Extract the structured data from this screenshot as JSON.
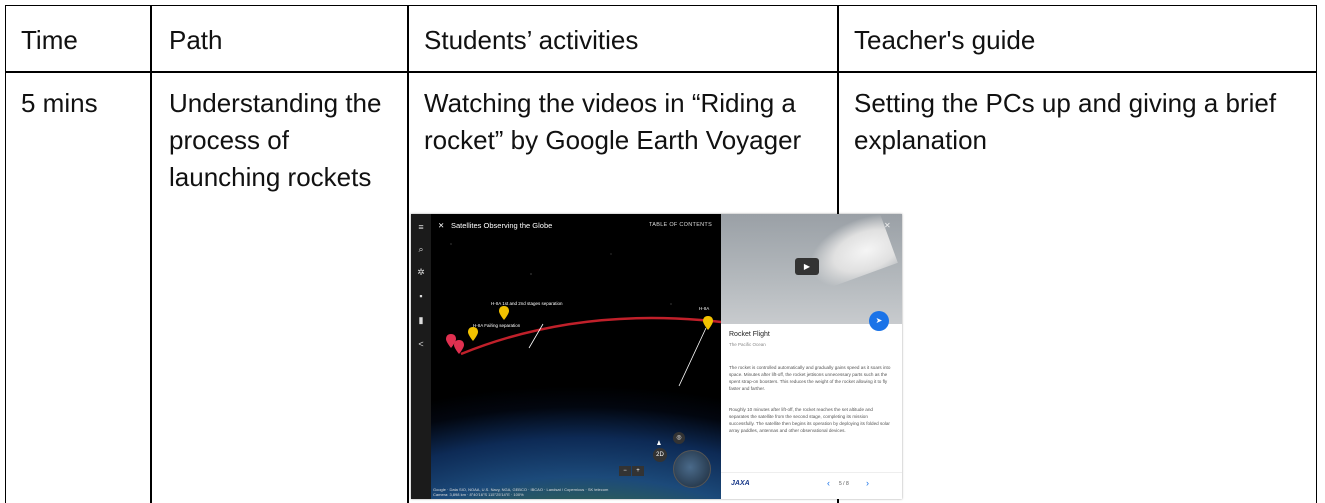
{
  "table": {
    "headers": [
      "Time",
      "Path",
      "Students’ activities",
      "Teacher's guide"
    ],
    "row": {
      "time": "5 mins",
      "path": "Understanding the process of launching rockets",
      "activity": "Watching the videos in “Riding a rocket” by Google Earth Voyager",
      "guide": "Setting the PCs up and giving a brief explanation"
    }
  },
  "screenshot": {
    "title": "Satellites Observing the Globe",
    "toc_label": "TABLE OF CONTENTS",
    "pins": [
      "H-IIA 1st and 2nd stages separation",
      "H-IIA Fairing separation",
      "H-IIA"
    ],
    "panel_title": "Rocket Flight",
    "panel_subtitle": "The Pacific Ocean",
    "paragraph1": "The rocket is controlled automatically and gradually gains speed as it soars into space. Minutes after lift-off, the rocket jettisons unnecessary parts such as the spent strap-on boosters. This reduces the weight of the rocket allowing it to fly faster and farther.",
    "paragraph2": "Roughly 10 minutes after lift-off, the rocket reaches the set altitude and separates the satellite from the second stage, completing its mission successfully. The satellite then begins its operation by deploying its folded solar array paddles, antennas and other observational devices.",
    "logo": "JAXA",
    "pager": "5 / 8",
    "credits": "Google · Data SIO, NOAA, U.S. Navy, NGA, GEBCO · IBCAO · Landsat / Copernicus · SK telecom",
    "camera": "Camera: 3,898 km · 8°40'16\"S 115°25'14\"E · 100%",
    "view_mode": "2D",
    "icons": [
      "menu-icon",
      "close-icon",
      "search-icon",
      "voyager-icon",
      "dice-icon",
      "bookmark-icon",
      "share-icon",
      "play-icon",
      "send-icon",
      "chevron-left-icon",
      "chevron-right-icon",
      "pegman-icon",
      "locate-icon",
      "zoom-out-icon",
      "zoom-in-icon"
    ]
  }
}
